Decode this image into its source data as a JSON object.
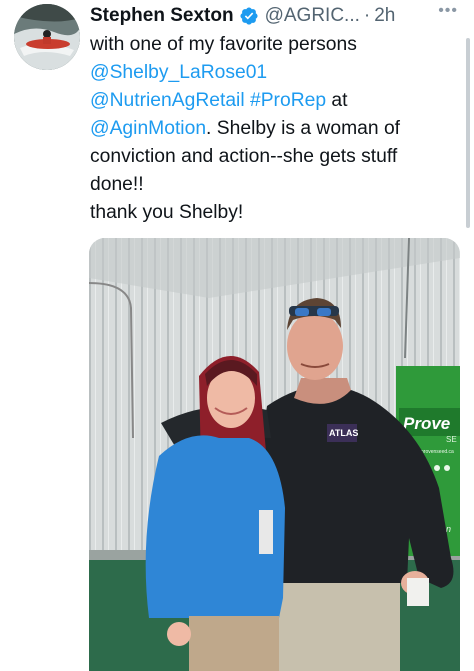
{
  "tweet": {
    "author_name": "Stephen Sexton",
    "handle": "@AGRIC...",
    "separator": "·",
    "time": "2h",
    "more_label": "•••",
    "lines": [
      {
        "parts": [
          {
            "text": "with one of my favorite persons",
            "link": false
          }
        ]
      },
      {
        "parts": [
          {
            "text": "@Shelby_LaRose01",
            "link": true
          }
        ]
      },
      {
        "parts": [
          {
            "text": "@NutrienAgRetail",
            "link": true
          },
          {
            "text": " ",
            "link": false
          },
          {
            "text": "#ProRep",
            "link": true
          },
          {
            "text": " at",
            "link": false
          }
        ]
      },
      {
        "parts": [
          {
            "text": "@AginMotion",
            "link": true
          },
          {
            "text": ". Shelby is a woman of",
            "link": false
          }
        ]
      },
      {
        "parts": [
          {
            "text": "conviction and action--she gets stuff",
            "link": false
          }
        ]
      },
      {
        "parts": [
          {
            "text": "done!!",
            "link": false
          }
        ]
      },
      {
        "parts": [
          {
            "text": "thank you Shelby!",
            "link": false
          }
        ]
      }
    ]
  },
  "photo": {
    "shirt_logo": "ATLAS",
    "banner_brand": "Prove",
    "banner_url": "provenseed.ca",
    "banner_suffix": "SE",
    "banner_bottom": "ien",
    "colors": {
      "banner_green": "#2f9a3a",
      "jacket_blue": "#2f86d6",
      "floor_green": "#2d6b4b",
      "link_blue": "#1d9bf0"
    }
  }
}
